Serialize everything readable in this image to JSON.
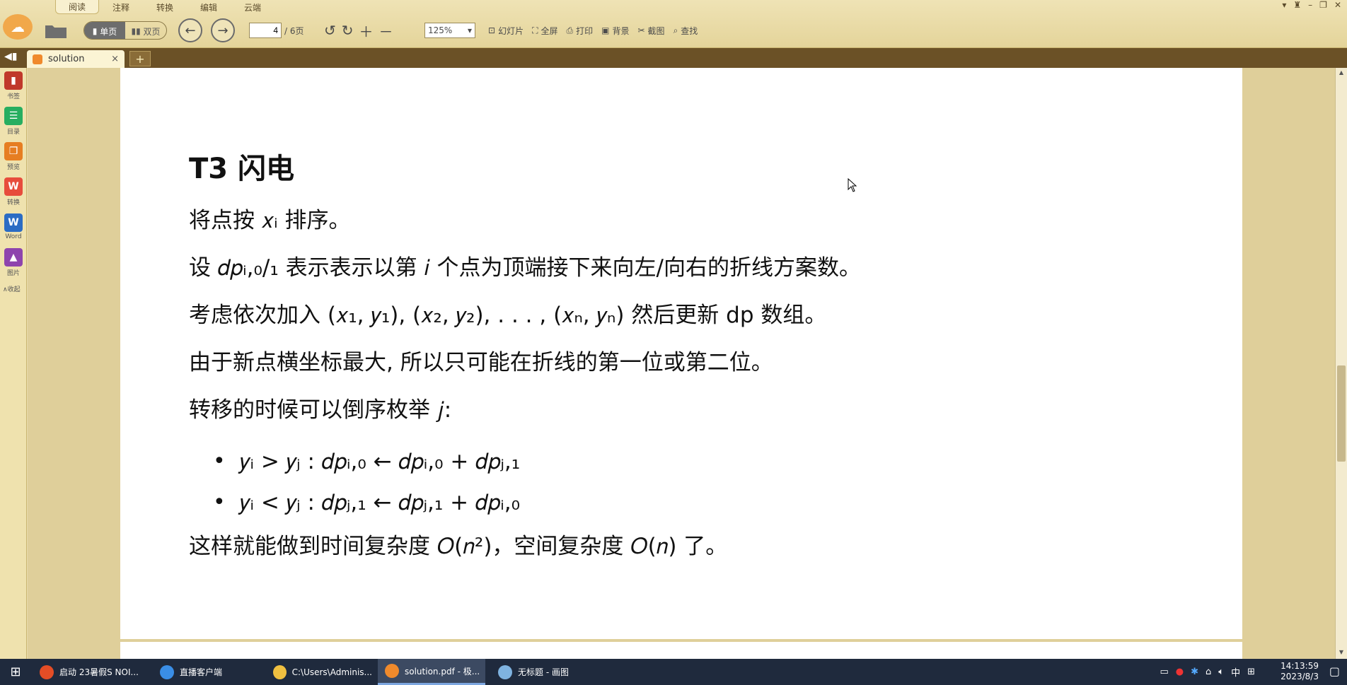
{
  "menu_tabs": [
    "阅读",
    "注释",
    "转换",
    "编辑",
    "云端"
  ],
  "toolbar": {
    "single_page": "单页",
    "double_page": "双页",
    "page_current": "4",
    "page_total": "/ 6页",
    "zoom": "125%",
    "slideshow": "幻灯片",
    "fullscreen": "全屏",
    "print": "打印",
    "background": "背景",
    "screenshot": "截图",
    "find": "查找"
  },
  "tab": {
    "title": "solution",
    "close": "×",
    "add": "+"
  },
  "sidebar": {
    "items": [
      {
        "label": "书签",
        "color": "#c0392b",
        "glyph": "▮"
      },
      {
        "label": "目录",
        "color": "#27ae60",
        "glyph": "☰"
      },
      {
        "label": "预览",
        "color": "#e67e22",
        "glyph": "❐"
      },
      {
        "label": "转换",
        "color": "#e74c3c",
        "glyph": "W"
      },
      {
        "label": "Word",
        "color": "#2b6cc4",
        "glyph": "W"
      },
      {
        "label": "图片",
        "color": "#8e44ad",
        "glyph": "▲"
      }
    ],
    "collapse": "∧收起"
  },
  "document": {
    "heading": "T3 闪电",
    "lines": [
      "将点按 𝑥ᵢ 排序。",
      "设 𝑑𝑝ᵢ,₀/₁ 表示表示以第 𝑖 个点为顶端接下来向左/向右的折线方案数。",
      "考虑依次加入 (𝑥₁, 𝑦₁), (𝑥₂, 𝑦₂), . . . , (𝑥ₙ, 𝑦ₙ) 然后更新 dp 数组。",
      "由于新点横坐标最大, 所以只可能在折线的第一位或第二位。",
      "转移的时候可以倒序枚举 𝑗:"
    ],
    "bullets": [
      "𝑦ᵢ > 𝑦ⱼ : 𝑑𝑝ᵢ,₀ ← 𝑑𝑝ᵢ,₀ + 𝑑𝑝ⱼ,₁",
      "𝑦ᵢ < 𝑦ⱼ : 𝑑𝑝ⱼ,₁ ← 𝑑𝑝ⱼ,₁ + 𝑑𝑝ᵢ,₀"
    ],
    "conclusion": "这样就能做到时间复杂度 𝑂(𝑛²)，空间复杂度 𝑂(𝑛) 了。"
  },
  "taskbar": {
    "items": [
      {
        "label": "启动 23暑假S NOI...",
        "color": "#e44d26"
      },
      {
        "label": "直播客户端",
        "color": "#3a8ee6"
      },
      {
        "label": "C:\\Users\\Adminis...",
        "color": "#f0c040"
      },
      {
        "label": "solution.pdf - 极...",
        "color": "#f08a2c"
      },
      {
        "label": "无标题 - 画图",
        "color": "#7fb3e0"
      }
    ],
    "ime": "中",
    "time": "14:13:59",
    "date": "2023/8/3"
  }
}
